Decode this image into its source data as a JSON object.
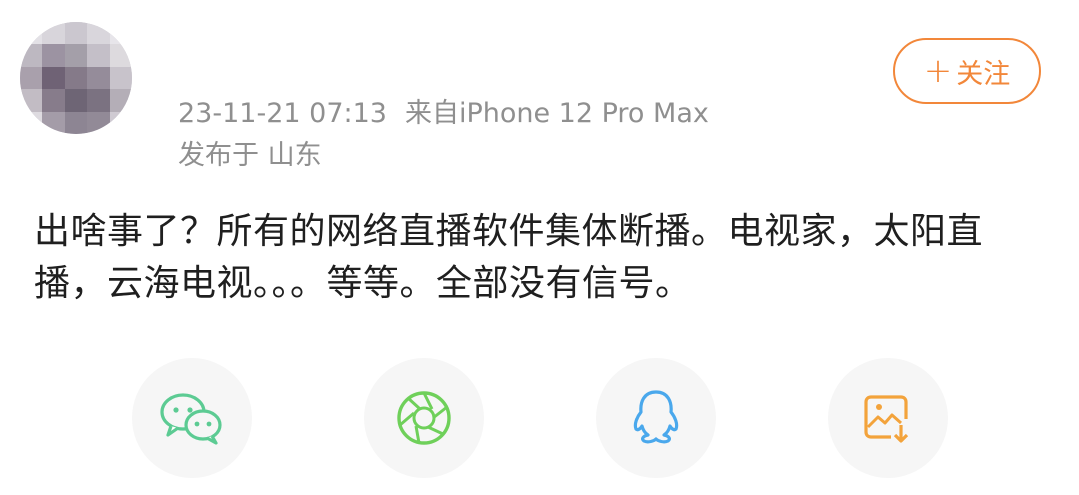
{
  "post": {
    "author": {
      "name": ""
    },
    "meta": {
      "time": "23-11-21 07:13",
      "source": "来自iPhone 12 Pro Max",
      "location": "发布于 山东"
    },
    "follow_label": "关注",
    "follow_symbol": "+",
    "content": "出啥事了？所有的网络直播软件集体断播。电视家，太阳直播，云海电视。。。等等。全部没有信号。"
  },
  "share": [
    {
      "icon": "wechat-icon",
      "color": "#5ccb93"
    },
    {
      "icon": "moments-shutter-icon",
      "color": "#6fd05a"
    },
    {
      "icon": "qq-penguin-icon",
      "color": "#4aa8ec"
    },
    {
      "icon": "save-image-icon",
      "color": "#f3a33b"
    }
  ],
  "colors": {
    "accent": "#f2873a",
    "meta_text": "#8f8f8f",
    "body_text": "#1f1f1f",
    "share_bg": "#f6f6f6"
  }
}
